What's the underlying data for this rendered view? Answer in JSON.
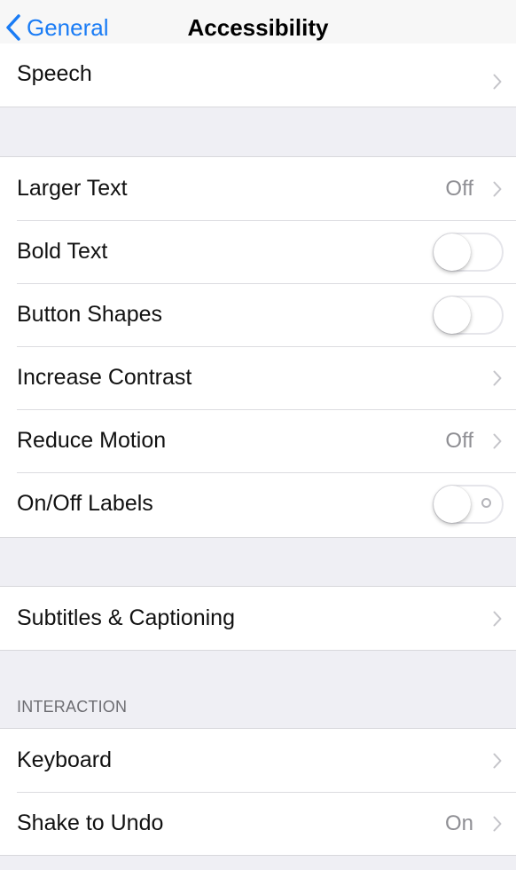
{
  "nav": {
    "back_label": "General",
    "title": "Accessibility"
  },
  "colors": {
    "accent": "#1a7cf5",
    "background": "#efeff4",
    "secondary_text": "#8e8e93"
  },
  "groups": {
    "speech": {
      "label": "Speech"
    },
    "vision": {
      "larger_text": {
        "label": "Larger Text",
        "value": "Off"
      },
      "bold_text": {
        "label": "Bold Text",
        "on": false
      },
      "button_shapes": {
        "label": "Button Shapes",
        "on": false
      },
      "increase_contrast": {
        "label": "Increase Contrast"
      },
      "reduce_motion": {
        "label": "Reduce Motion",
        "value": "Off"
      },
      "onoff_labels": {
        "label": "On/Off Labels",
        "on": false
      }
    },
    "media": {
      "subtitles": {
        "label": "Subtitles & Captioning"
      }
    },
    "interaction": {
      "header": "INTERACTION",
      "keyboard": {
        "label": "Keyboard"
      },
      "shake_to_undo": {
        "label": "Shake to Undo",
        "value": "On"
      }
    }
  },
  "icons": {
    "back": "chevron-left-icon",
    "disclosure": "chevron-right-icon"
  }
}
